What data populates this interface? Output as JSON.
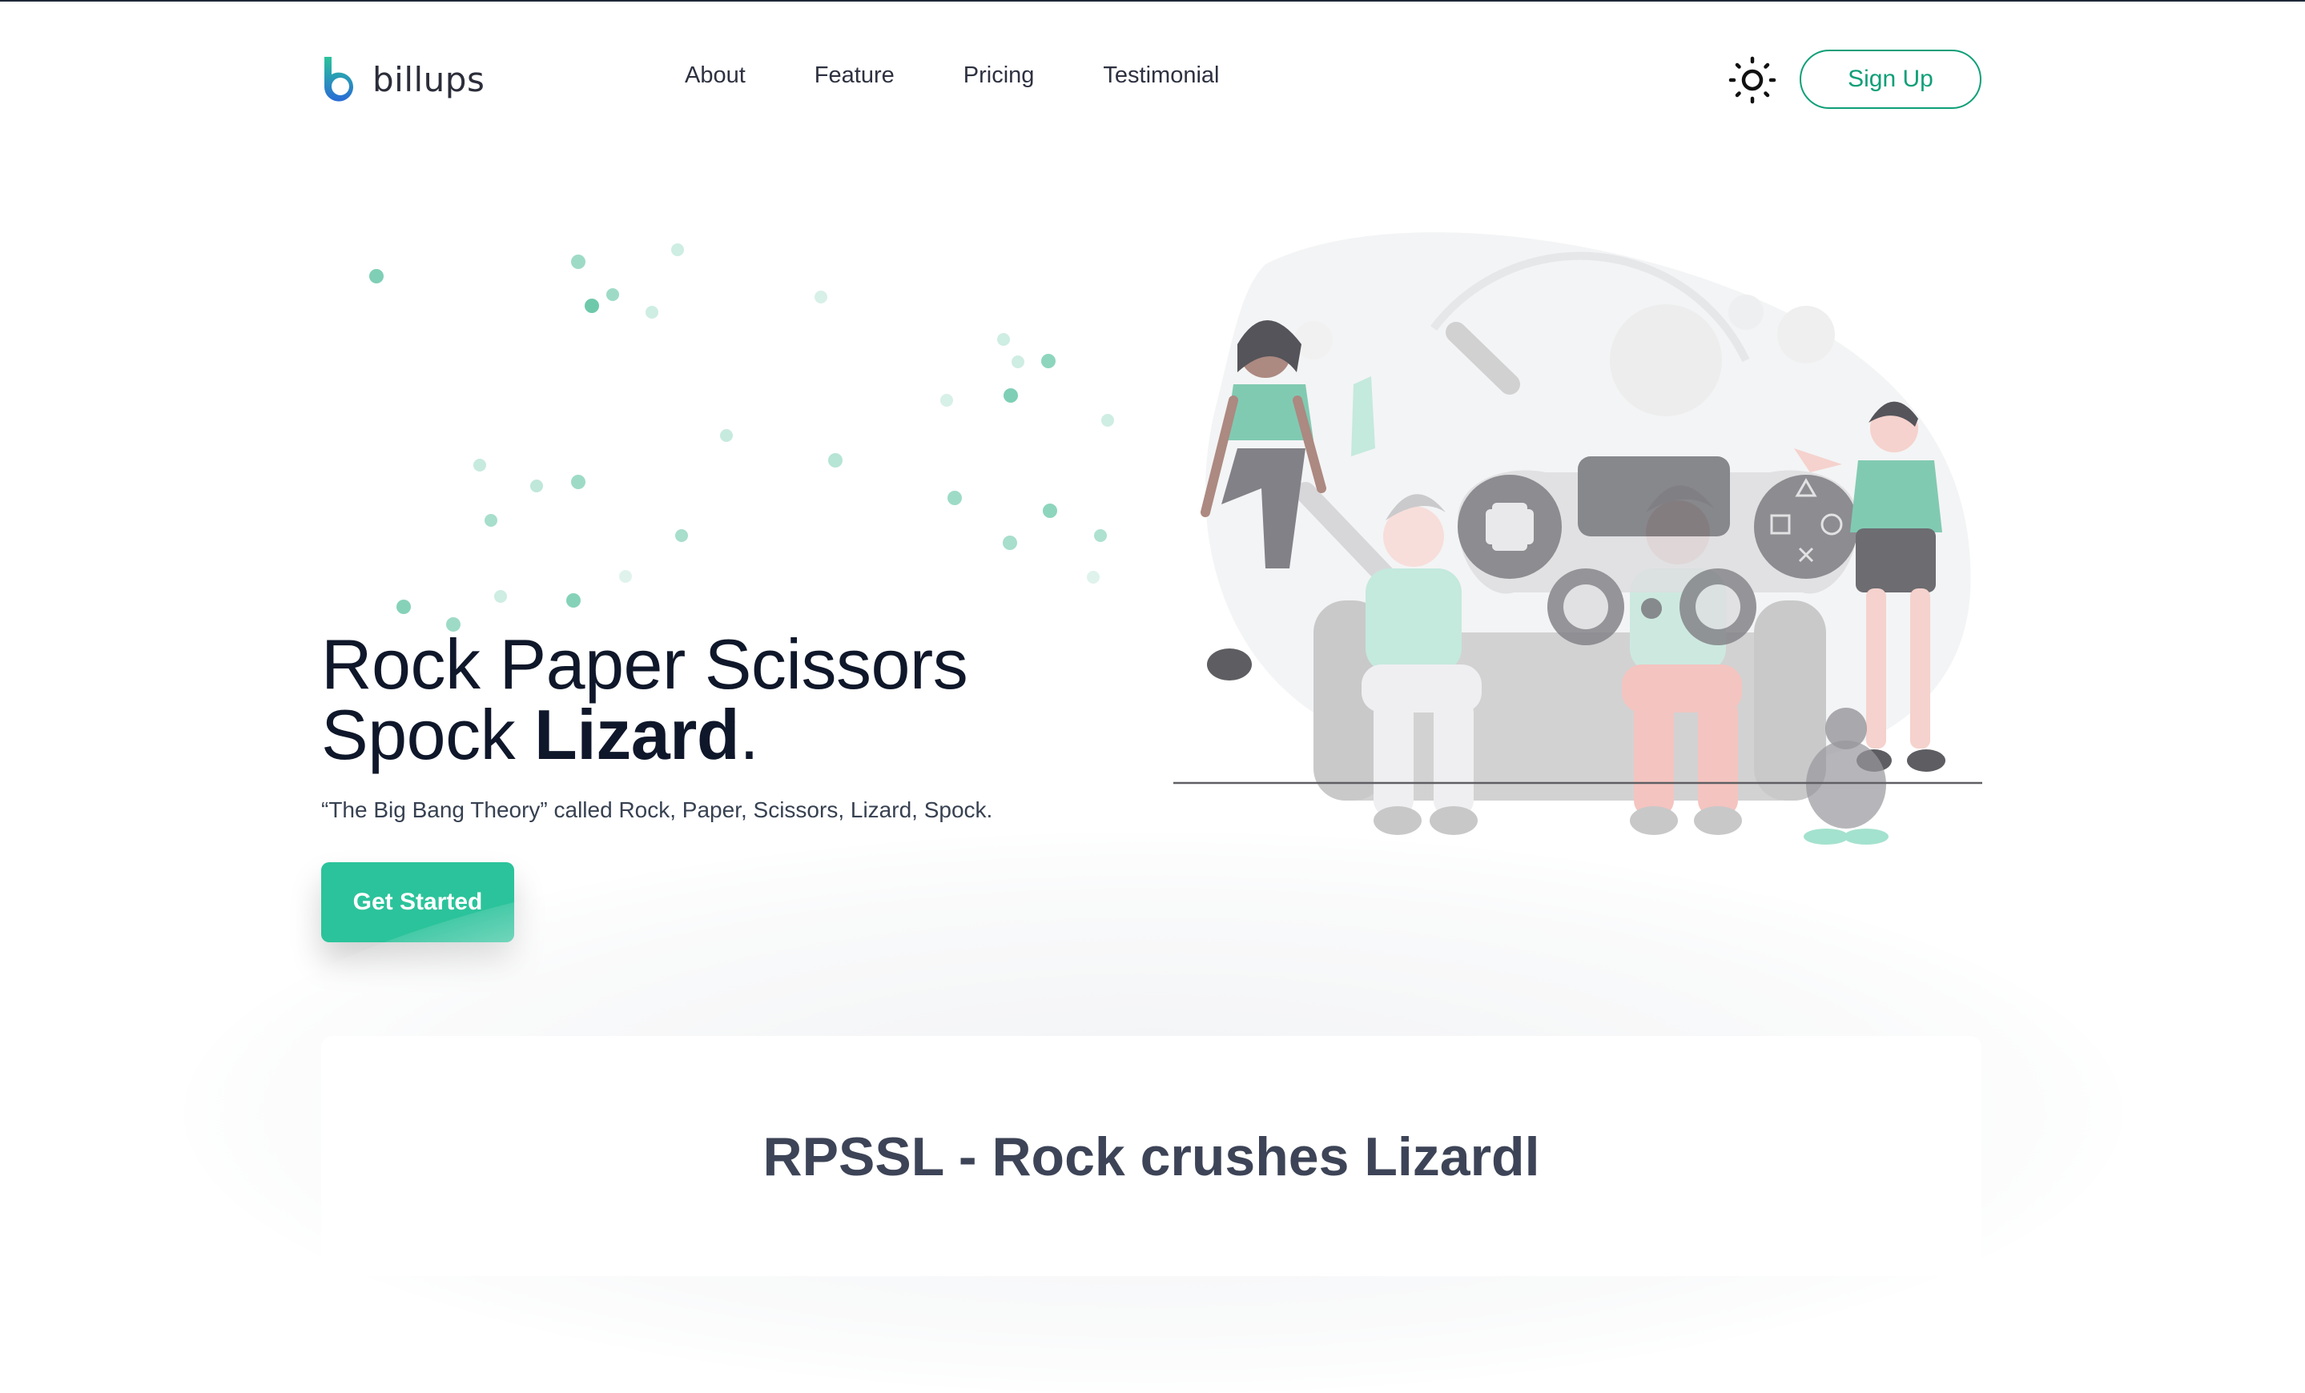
{
  "brand": {
    "name": "billups",
    "colors": {
      "accent": "#2bc39b",
      "outline": "#0f9f78",
      "logo_top": "#2bc39b",
      "logo_bottom": "#2a6bd6"
    }
  },
  "nav": {
    "items": [
      "About",
      "Feature",
      "Pricing",
      "Testimonial"
    ]
  },
  "header": {
    "theme_icon": "sun-icon",
    "signup_label": "Sign Up"
  },
  "hero": {
    "title_line1": "Rock Paper Scissors",
    "title_line2_regular": "Spock ",
    "title_line2_bold": "Lizard",
    "title_period": ".",
    "subtitle": "“The Big Bang Theory” called Rock, Paper, Scissors, Lizard, Spock.",
    "cta_label": "Get Started",
    "illustration": "friends-playing-video-games-illustration"
  },
  "section": {
    "title": "RPSSL - Rock crushes Lizardl"
  }
}
